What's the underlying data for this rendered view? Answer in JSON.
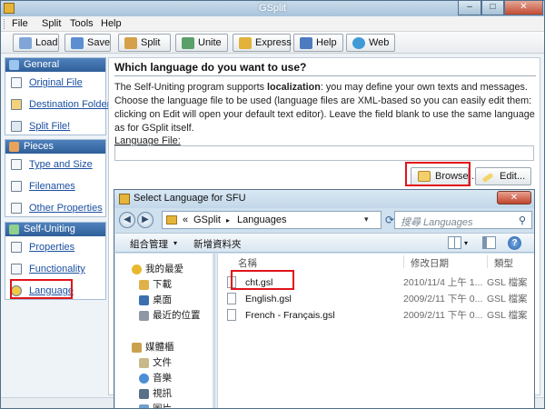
{
  "window": {
    "title": "GSplit",
    "minimize_glyph": "–",
    "maximize_glyph": "□",
    "close_glyph": "✕"
  },
  "menu": [
    "File",
    "Split",
    "Tools",
    "Help"
  ],
  "toolbar": [
    {
      "label": "Load",
      "icon": "load-icon",
      "color": "#7fa6d6"
    },
    {
      "label": "Save",
      "icon": "save-icon",
      "color": "#5b8fd0"
    },
    {
      "label": "Split",
      "icon": "split-icon",
      "color": "#d6a04a"
    },
    {
      "label": "Unite",
      "icon": "unite-icon",
      "color": "#5aa06a"
    },
    {
      "label": "Express",
      "icon": "express-icon",
      "color": "#e2b23a"
    },
    {
      "label": "Help",
      "icon": "help-book-icon",
      "color": "#4d7bc0"
    },
    {
      "label": "Web",
      "icon": "web-globe-icon",
      "color": "#3f9bd6"
    }
  ],
  "sidebar": {
    "groups": [
      {
        "title": "General",
        "icon": "general-icon",
        "items": [
          {
            "label": "Original File",
            "icon": "original-file-icon"
          },
          {
            "label": "Destination Folder",
            "icon": "destination-folder-icon"
          },
          {
            "label": "Split File!",
            "icon": "split-file-icon"
          }
        ]
      },
      {
        "title": "Pieces",
        "icon": "pieces-icon",
        "items": [
          {
            "label": "Type and Size",
            "icon": "type-size-icon"
          },
          {
            "label": "Filenames",
            "icon": "filenames-icon"
          },
          {
            "label": "Other Properties",
            "icon": "other-properties-icon"
          }
        ]
      },
      {
        "title": "Self-Uniting",
        "icon": "self-uniting-icon",
        "items": [
          {
            "label": "Properties",
            "icon": "properties-icon"
          },
          {
            "label": "Functionality",
            "icon": "functionality-icon"
          },
          {
            "label": "Language",
            "icon": "language-icon"
          }
        ]
      }
    ]
  },
  "main": {
    "heading": "Which language do you want to use?",
    "description_before": "The Self-Uniting program supports ",
    "description_bold": "localization",
    "description_after": ": you may define your own texts and messages. Choose the language file to be used (language files are XML-based so you can easily edit them: clicking on Edit will open your default text editor). Leave the field blank to use the same language as for GSplit itself.",
    "language_file_label": "Language File:",
    "language_file_value": "",
    "browse_label": "Browse...",
    "edit_label": "Edit..."
  },
  "dialog": {
    "title": "Select Language for SFU",
    "close_glyph": "✕",
    "back_glyph": "◀",
    "forward_glyph": "▶",
    "breadcrumb_prefix": "«",
    "breadcrumb": [
      "GSplit",
      "Languages"
    ],
    "crumb_sep": "▸",
    "dropdown_glyph": "▾",
    "refresh_glyph": "⟳",
    "search_placeholder": "搜尋 Languages",
    "search_glyph": "⚲",
    "toolbar": {
      "organize": "組合管理",
      "new_folder": "新增資料夾",
      "help_glyph": "?"
    },
    "nav": [
      {
        "label": "我的最愛",
        "icon": "favorites-star-icon",
        "color": "#e8b82e",
        "indent": 0
      },
      {
        "label": "下載",
        "icon": "downloads-icon",
        "color": "#e0b04a",
        "indent": 1
      },
      {
        "label": "桌面",
        "icon": "desktop-icon",
        "color": "#3b6fb0",
        "indent": 1
      },
      {
        "label": "最近的位置",
        "icon": "recent-places-icon",
        "color": "#8d98a4",
        "indent": 1
      },
      {
        "label": "",
        "icon": "",
        "color": "",
        "indent": 0
      },
      {
        "label": "媒體櫃",
        "icon": "libraries-icon",
        "color": "#caa24e",
        "indent": 0
      },
      {
        "label": "文件",
        "icon": "documents-icon",
        "color": "#c9b88a",
        "indent": 1
      },
      {
        "label": "音樂",
        "icon": "music-icon",
        "color": "#4b8fd6",
        "indent": 1
      },
      {
        "label": "視訊",
        "icon": "videos-icon",
        "color": "#5b6f86",
        "indent": 1
      },
      {
        "label": "圖片",
        "icon": "pictures-icon",
        "color": "#6fa0cf",
        "indent": 1
      }
    ],
    "columns": {
      "name": "名稱",
      "date": "修改日期",
      "type": "類型"
    },
    "files": [
      {
        "name": "cht.gsl",
        "date": "2010/11/4 上午 1...",
        "type": "GSL 檔案"
      },
      {
        "name": "English.gsl",
        "date": "2009/2/11 下午 0...",
        "type": "GSL 檔案"
      },
      {
        "name": "French - Français.gsl",
        "date": "2009/2/11 下午 0...",
        "type": "GSL 檔案"
      }
    ]
  },
  "highlight_color": "#e0141b"
}
